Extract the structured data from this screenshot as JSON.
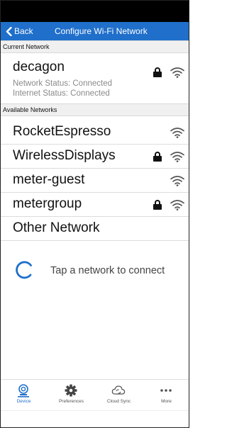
{
  "navbar": {
    "back_label": "Back",
    "title": "Configure Wi-Fi Network"
  },
  "current_section": {
    "header": "Current Network",
    "network": {
      "name": "decagon",
      "network_status": "Network Status: Connected",
      "internet_status": "Internet Status: Connected",
      "secured": true
    }
  },
  "available_section": {
    "header": "Available Networks",
    "networks": [
      {
        "name": "RocketEspresso",
        "secured": false
      },
      {
        "name": "WirelessDisplays",
        "secured": true
      },
      {
        "name": "meter-guest",
        "secured": false
      },
      {
        "name": "metergroup",
        "secured": true
      }
    ],
    "other_label": "Other Network"
  },
  "connect_hint": "Tap a network to connect",
  "tabs": [
    {
      "label": "Device",
      "icon": "device-icon",
      "active": true
    },
    {
      "label": "Preferences",
      "icon": "gear-icon",
      "active": false
    },
    {
      "label": "Cloud Sync",
      "icon": "cloud-sync-icon",
      "active": false
    },
    {
      "label": "More",
      "icon": "more-dots-icon",
      "active": false
    }
  ],
  "colors": {
    "accent": "#1f6fcb",
    "status_bar": "#000000",
    "section_header_bg": "#f0f0f0",
    "muted_text": "#8a8a8a"
  }
}
